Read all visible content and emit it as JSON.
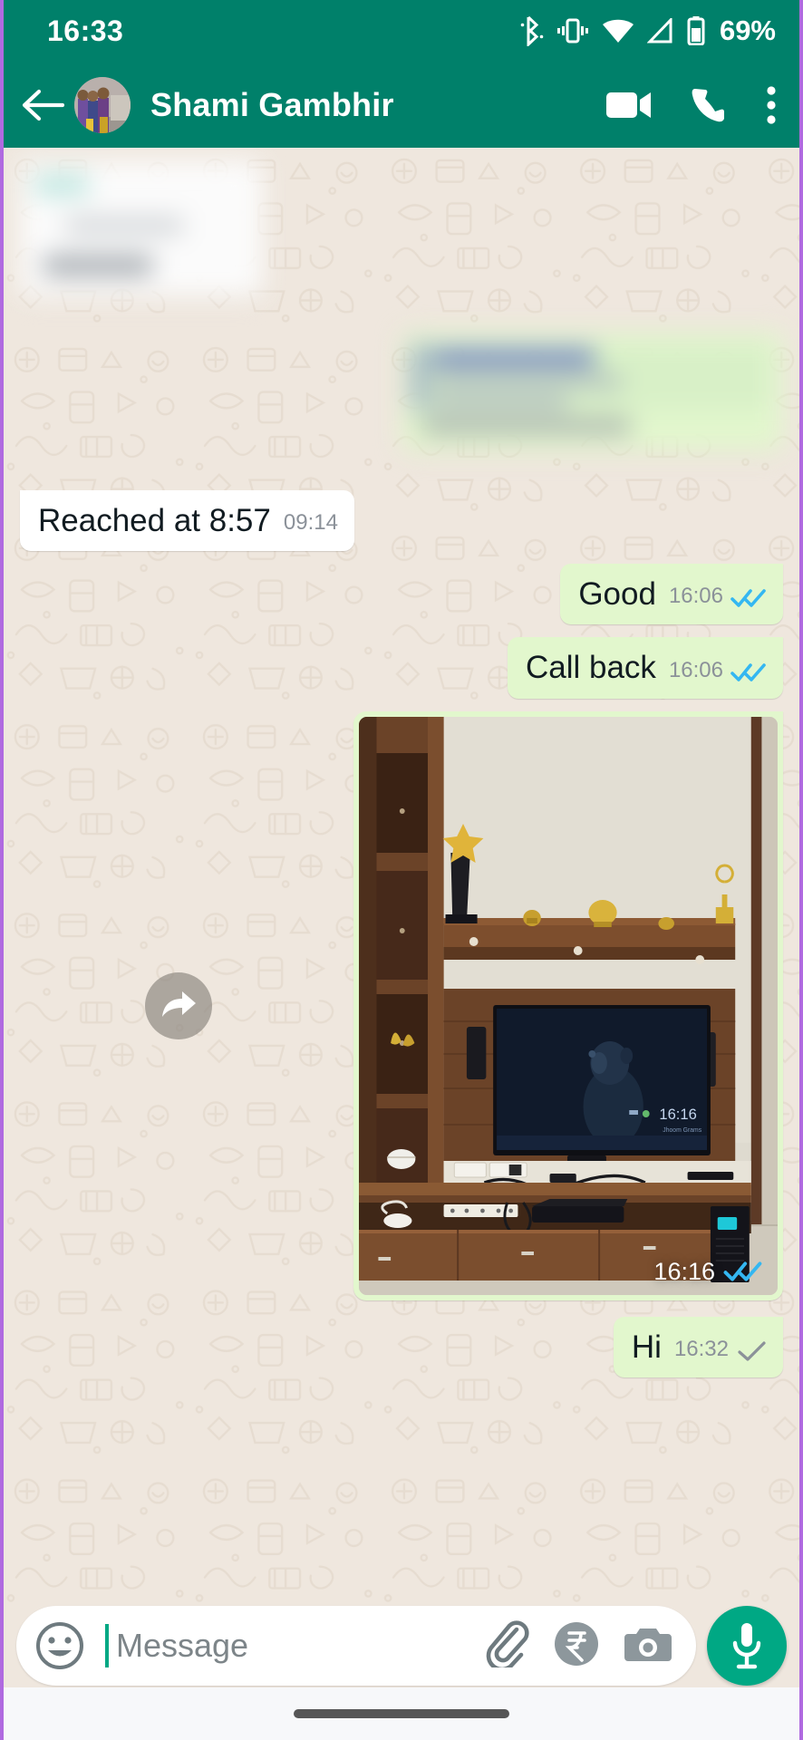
{
  "status_bar": {
    "clock": "16:33",
    "battery_percent": "69%",
    "icons": [
      "bluetooth-icon",
      "vibrate-icon",
      "wifi-icon",
      "cellular-signal-icon",
      "battery-icon"
    ]
  },
  "app_bar": {
    "back_icon": "back-arrow-icon",
    "avatar": "contact-avatar",
    "contact_name": "Shami Gambhir",
    "actions": [
      {
        "name": "video-call-button",
        "icon": "video-camera-icon"
      },
      {
        "name": "voice-call-button",
        "icon": "phone-icon"
      },
      {
        "name": "more-options-button",
        "icon": "overflow-menu-icon"
      }
    ]
  },
  "colors": {
    "header_green": "#00806a",
    "accent_green": "#00a884",
    "outgoing_bubble": "#e2f7cd",
    "incoming_bubble": "#ffffff",
    "chat_background": "#efe7de",
    "tick_blue": "#34b7f1",
    "tick_gray": "#8b9199"
  },
  "messages": [
    {
      "id": "m1",
      "direction": "in",
      "blurred": true,
      "text": "",
      "time": "",
      "status": ""
    },
    {
      "id": "m2",
      "direction": "out",
      "blurred": true,
      "text": "",
      "time": "",
      "status": ""
    },
    {
      "id": "m3",
      "direction": "in",
      "blurred": false,
      "text": "Reached at 8:57",
      "time": "09:14",
      "status": "none"
    },
    {
      "id": "m4",
      "direction": "out",
      "blurred": false,
      "text": "Good",
      "time": "16:06",
      "status": "read"
    },
    {
      "id": "m5",
      "direction": "out",
      "blurred": false,
      "text": "Call back",
      "time": "16:06",
      "status": "read"
    },
    {
      "id": "m6",
      "direction": "out",
      "blurred": false,
      "type": "image",
      "time": "16:16",
      "status": "read",
      "photo_description": "Wooden TV wall unit with wall-mounted television showing a monkey on a dark blue screen, display clock 16:16, floating shelf with trophies and gold ornaments, lower cabinet with drawers, set-top box, router, cables and a black UPS with blue indicator",
      "forward_button": "forward-message-button"
    },
    {
      "id": "m7",
      "direction": "out",
      "blurred": false,
      "text": "Hi",
      "time": "16:32",
      "status": "sent"
    }
  ],
  "composer": {
    "emoji_icon": "emoji-smiley-icon",
    "placeholder": "Message",
    "attach_icon": "paperclip-icon",
    "payment_icon": "rupee-payment-icon",
    "camera_icon": "camera-icon",
    "mic_icon": "microphone-icon"
  },
  "nav_bar": {
    "gesture_pill": "home-gesture-pill"
  }
}
